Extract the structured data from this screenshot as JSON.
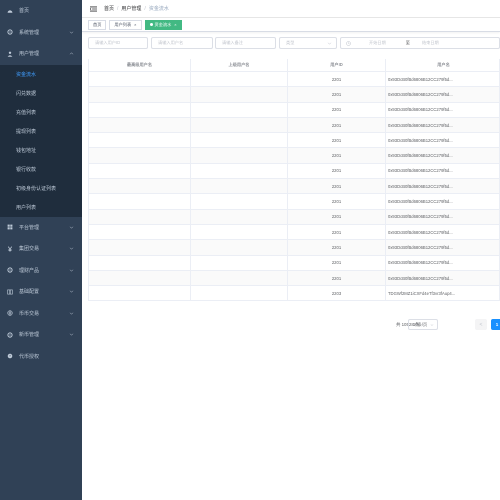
{
  "sidebar": {
    "items": [
      {
        "label": "首页",
        "icon": "dashboard-icon"
      },
      {
        "label": "系统管理",
        "icon": "gear-icon"
      },
      {
        "label": "用户管理",
        "icon": "user-icon",
        "expanded": true
      },
      {
        "label": "平台管理",
        "icon": "grid-icon"
      },
      {
        "label": "集团交易",
        "icon": "yen-icon"
      },
      {
        "label": "理财产品",
        "icon": "gear-icon"
      },
      {
        "label": "基础配置",
        "icon": "book-icon"
      },
      {
        "label": "币币交易",
        "icon": "globe-icon"
      },
      {
        "label": "新币管理",
        "icon": "gear-icon"
      },
      {
        "label": "代币授权",
        "icon": "shield-icon"
      }
    ],
    "submenu": [
      {
        "label": "资金流水",
        "active": true
      },
      {
        "label": "闪兑数据"
      },
      {
        "label": "充值列表"
      },
      {
        "label": "提现列表"
      },
      {
        "label": "钱包地址"
      },
      {
        "label": "银行收款"
      },
      {
        "label": "初级身份认证列表"
      },
      {
        "label": "用户列表"
      }
    ]
  },
  "header": {
    "breadcrumb": [
      "首页",
      "用户管理",
      "资金流水"
    ]
  },
  "tags": [
    {
      "label": "首页"
    },
    {
      "label": "用户列表"
    },
    {
      "label": "资金流水",
      "active": true
    }
  ],
  "filters": {
    "user_id_placeholder": "请输入用户ID",
    "username_placeholder": "请输入用户名",
    "remark_placeholder": "请输入备注",
    "type_placeholder": "类型",
    "start_date_placeholder": "开始日期",
    "range_separator": "至",
    "end_date_placeholder": "结束日期"
  },
  "table": {
    "headers": [
      "最高级用户名",
      "上级用户名",
      "用户ID",
      "用户名"
    ],
    "rows": [
      [
        "",
        "",
        "2201",
        "0x93DcB0fBd6806B12CC279f5d..."
      ],
      [
        "",
        "",
        "2201",
        "0x93DcB0fBd6806B12CC279f5d..."
      ],
      [
        "",
        "",
        "2201",
        "0x93DcB0fBd6806B12CC279f5d..."
      ],
      [
        "",
        "",
        "2201",
        "0x93DcB0fBd6806B12CC279f5d..."
      ],
      [
        "",
        "",
        "2201",
        "0x93DcB0fBd6806B12CC279f5d..."
      ],
      [
        "",
        "",
        "2201",
        "0x93DcB0fBd6806B12CC279f5d..."
      ],
      [
        "",
        "",
        "2201",
        "0x93DcB0fBd6806B12CC279f5d..."
      ],
      [
        "",
        "",
        "2201",
        "0x93DcB0fBd6806B12CC279f5d..."
      ],
      [
        "",
        "",
        "2201",
        "0x93DcB0fBd6806B12CC279f5d..."
      ],
      [
        "",
        "",
        "2201",
        "0x93DcB0fBd6806B12CC279f5d..."
      ],
      [
        "",
        "",
        "2201",
        "0x93DcB0fBd6806B12CC279f5d..."
      ],
      [
        "",
        "",
        "2201",
        "0x93DcB0fBd6806B12CC279f5d..."
      ],
      [
        "",
        "",
        "2201",
        "0x93DcB0fBd6806B12CC279f5d..."
      ],
      [
        "",
        "",
        "2201",
        "0x93DcB0fBd6806B12CC279f5d..."
      ],
      [
        "",
        "",
        "2203",
        "TDGWf2MZ1iCXFd4eTf3vr3fAup4..."
      ]
    ]
  },
  "pagination": {
    "total": "共 10528 条",
    "page_size": "10条/页",
    "prev": "<",
    "current": "1"
  },
  "colors": {
    "sidebar_bg": "#304156",
    "submenu_bg": "#1f2d3d",
    "active_text": "#409eff",
    "active_tag": "#42b983",
    "page_active": "#1890ff"
  }
}
